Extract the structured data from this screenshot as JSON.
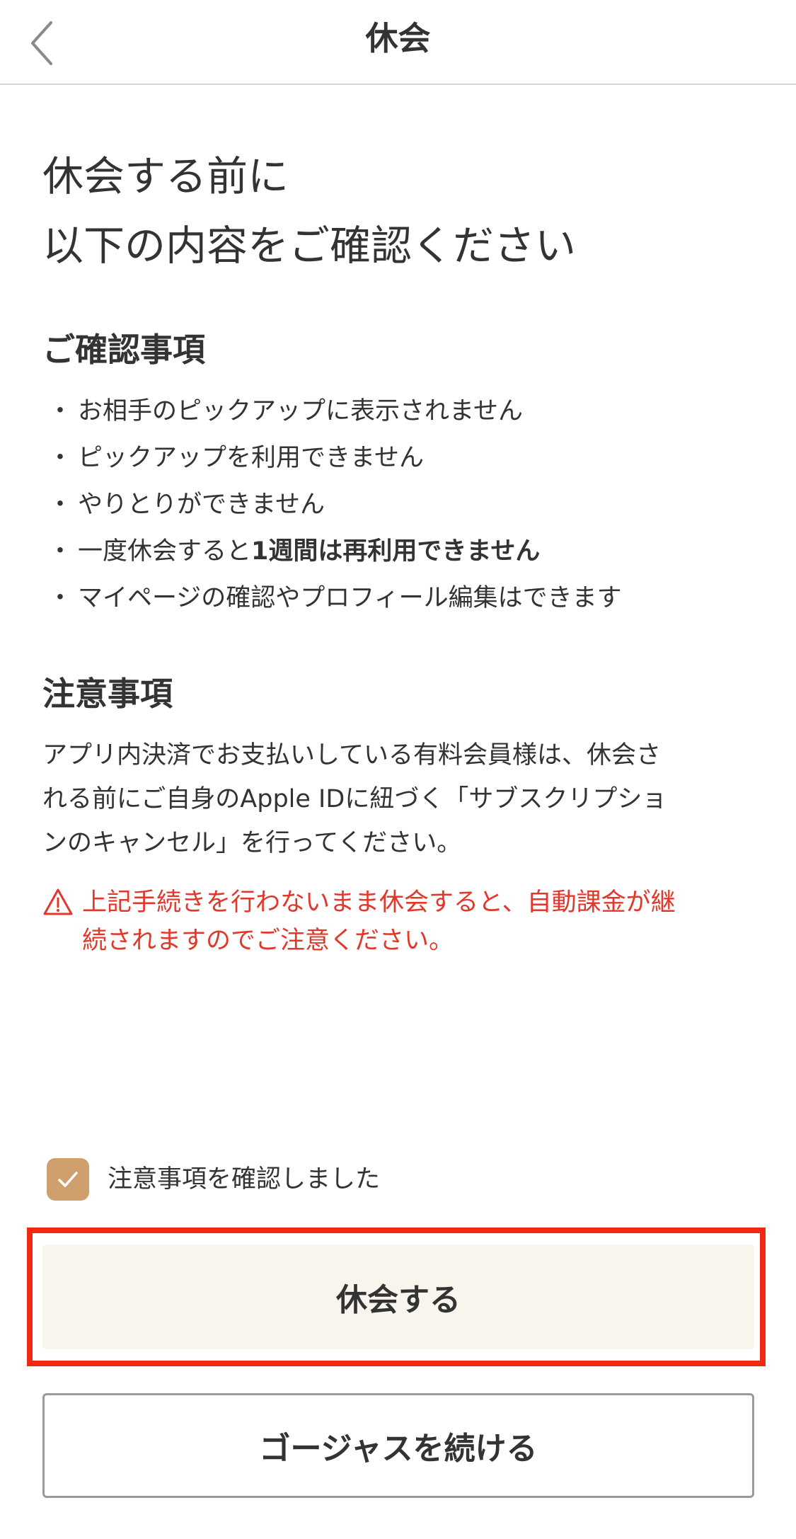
{
  "header": {
    "title": "休会",
    "back_icon": "chevron-left-icon"
  },
  "main": {
    "heading_line1": "休会する前に",
    "heading_line2": "以下の内容をご確認ください"
  },
  "confirm": {
    "title": "ご確認事項",
    "bullet": "・",
    "items": [
      {
        "text": "お相手のピックアップに表示されません"
      },
      {
        "text": "ピックアップを利用できません"
      },
      {
        "text": "やりとりができません"
      },
      {
        "text": "一度休会すると",
        "strong": "1週間は再利用できません"
      },
      {
        "text": "マイページの確認やプロフィール編集はできます"
      }
    ]
  },
  "caution": {
    "title": "注意事項",
    "lines": [
      "アプリ内決済でお支払いしている有料会員様は、休会さ",
      "れる前にご自身のApple IDに紐づく「サブスクリプショ",
      "ンのキャンセル」を行ってください。"
    ],
    "warning_icon": "warning-triangle-icon",
    "warning_lines": [
      "上記手続きを行わないまま休会すると、自動課金が継",
      "続されますのでご注意ください。"
    ]
  },
  "agreement": {
    "checked": true,
    "label": "注意事項を確認しました"
  },
  "buttons": {
    "pause_label": "休会する",
    "continue_label": "ゴージャスを続ける"
  },
  "colors": {
    "accent_checkbox": "#cf9f6e",
    "warning_red": "#e0392b",
    "highlight_red": "#f02a12",
    "primary_bg": "#f8f6ec"
  }
}
